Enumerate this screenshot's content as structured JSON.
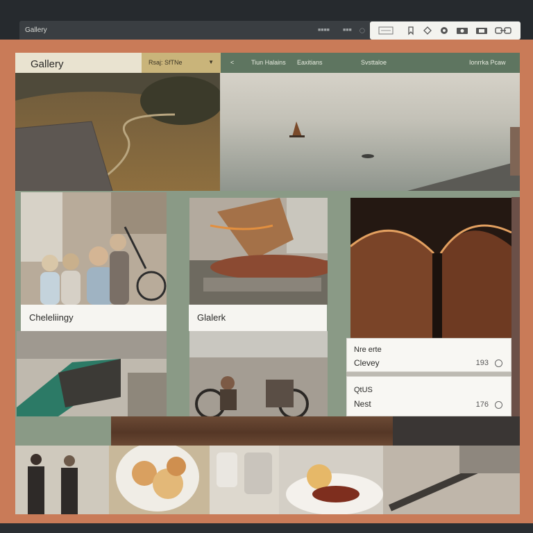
{
  "window": {
    "title": "Gallery",
    "mini_labels": [
      "■■■■",
      "■■■",
      "◯"
    ]
  },
  "toolbar": {
    "icons": [
      "calendar-icon",
      "bookmark-icon",
      "diamond-icon",
      "search-icon",
      "camera-icon",
      "camera-alt-icon",
      "link-icon"
    ]
  },
  "header": {
    "app_title": "Gallery",
    "dropdown_label": "Rsaj: SfTNe",
    "nav_back_icon": "chevron-left-icon",
    "nav": [
      "Tiun Halains",
      "Eaxitians",
      "Svsttaloe",
      "Ionrrka Pcaw"
    ]
  },
  "cards": {
    "family_caption": "Cheleliingy",
    "castle_caption": "Glalerk",
    "info1": {
      "line1": "Nre erte",
      "line2": "Clevey",
      "count": "193"
    },
    "info2": {
      "line1": "QtUS",
      "line2": "Nest",
      "count": "176"
    }
  },
  "colors": {
    "canvas": "#c97b58",
    "header_green": "#5e7560",
    "dropdown_gold": "#c9b47a",
    "panel_sage": "#8a9a86"
  }
}
